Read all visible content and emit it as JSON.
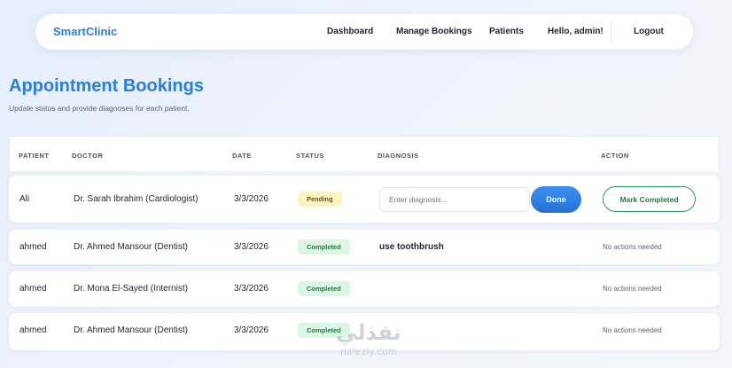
{
  "nav": {
    "brand": "SmartClinic",
    "links": [
      "Dashboard",
      "Manage Bookings",
      "Patients"
    ],
    "greeting": "Hello, admin!",
    "logout": "Logout"
  },
  "header": {
    "title": "Appointment Bookings",
    "subtitle": "Update status and provide diagnoses for each patient."
  },
  "table": {
    "columns": [
      "PATIENT",
      "DOCTOR",
      "DATE",
      "STATUS",
      "DIAGNOSIS",
      "ACTION"
    ],
    "rows": [
      {
        "patient": "Ali",
        "doctor": "Dr. Sarah Ibrahim (Cardiologist)",
        "date": "3/3/2026",
        "status": "Pending",
        "diagnosis_placeholder": "Enter diagnosis...",
        "done_label": "Done",
        "action_label": "Mark Completed"
      },
      {
        "patient": "ahmed",
        "doctor": "Dr. Ahmed Mansour (Dentist)",
        "date": "3/3/2026",
        "status": "Completed",
        "diagnosis": "use toothbrush",
        "action_text": "No actions needed"
      },
      {
        "patient": "ahmed",
        "doctor": "Dr. Mona El-Sayed (Internist)",
        "date": "3/3/2026",
        "status": "Completed",
        "diagnosis": "",
        "action_text": "No actions needed"
      },
      {
        "patient": "ahmed",
        "doctor": "Dr. Ahmed Mansour (Dentist)",
        "date": "3/3/2026",
        "status": "Completed",
        "diagnosis": "",
        "action_text": "No actions needed"
      }
    ]
  },
  "watermark": {
    "logo": "نفذلي",
    "text": "nafezly.com"
  },
  "colors": {
    "accent": "#2a7de1",
    "pending_bg": "#fdf3c4",
    "completed_bg": "#dcf6e4",
    "completed_text": "#1f7a43"
  }
}
